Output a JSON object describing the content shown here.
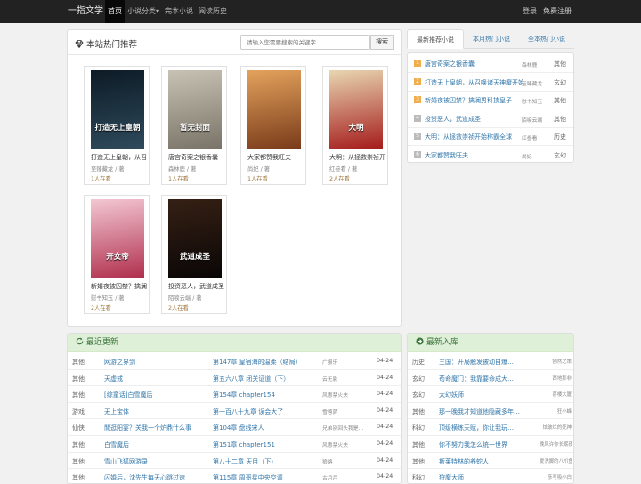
{
  "nav": {
    "brand": "一指文学",
    "links": [
      {
        "label": "首页",
        "active": true
      },
      {
        "label": "小说分类▾",
        "active": false
      },
      {
        "label": "完本小说",
        "active": false
      },
      {
        "label": "阅读历史",
        "active": false
      }
    ],
    "login": "登录",
    "register": "免费注册"
  },
  "hot": {
    "title": "本站热门推荐",
    "search_placeholder": "请输入您需要搜索的关键字",
    "search_button": "搜索",
    "books": [
      {
        "title": "打造无上皇朝，从召唤",
        "author": "至臻藏龙 / 著",
        "reading": "1人在看",
        "cover_colors": [
          "#0d1b26",
          "#2e4a5c"
        ],
        "cover_text": "打造无上皇朝"
      },
      {
        "title": "唐宫奇案之银香囊",
        "author": "森林鹿 / 著",
        "reading": "1人在看",
        "cover_colors": [
          "#c8c2b4",
          "#7a7468"
        ],
        "cover_text": "暂无封面"
      },
      {
        "title": "大家都赞我旺夫",
        "author": "尚妃 / 著",
        "reading": "1人在看",
        "cover_colors": [
          "#e3a25c",
          "#7a3b1a"
        ],
        "cover_text": ""
      },
      {
        "title": "大明：从拯救崇祯开始",
        "author": "红叁看 / 著",
        "reading": "2人在看",
        "cover_colors": [
          "#e8d6b0",
          "#a51c1c"
        ],
        "cover_text": "大明"
      },
      {
        "title": "新婚夜被囚禁？擒澜",
        "author": "慰书知玉 / 著",
        "reading": "2人在看",
        "cover_colors": [
          "#f3c7d3",
          "#b0304e"
        ],
        "cover_text": "开女帝"
      },
      {
        "title": "投资恶人，武道成圣",
        "author": "陌唳云端 / 著",
        "reading": "2人在看",
        "cover_colors": [
          "#352014",
          "#0a0606"
        ],
        "cover_text": "武道成圣"
      }
    ]
  },
  "rank": {
    "tabs": [
      "最新推荐小说",
      "本月热门小说",
      "全本热门小说"
    ],
    "num_colors": [
      "#f0ad4e",
      "#f0ad4e",
      "#f0ad4e",
      "#bbbbbb",
      "#bbbbbb",
      "#bbbbbb"
    ],
    "items": [
      {
        "num": "1",
        "title": "唐宫奇案之银香囊",
        "author": "森林鹿",
        "category": "其他"
      },
      {
        "num": "2",
        "title": "打造无上皇朝，从召唤诸天神魔开始",
        "author": "至臻藏龙",
        "category": "玄幻"
      },
      {
        "num": "3",
        "title": "新婚夜被囚禁？擒澜男科挟皇子",
        "author": "慰书知玉",
        "category": "其他"
      },
      {
        "num": "4",
        "title": "投资恶人，武道成圣",
        "author": "陌唳云端",
        "category": "其他"
      },
      {
        "num": "5",
        "title": "大明：从拯救崇祯开始称霸全球",
        "author": "红叁看",
        "category": "历史"
      },
      {
        "num": "6",
        "title": "大家都赞我旺夫",
        "author": "尚妃",
        "category": "玄幻"
      }
    ]
  },
  "recent": {
    "title": "最近更新",
    "rows": [
      {
        "cat": "其他",
        "title": "网游之界剑",
        "chapter": "第147章 皇宿海的温柔（结局）",
        "author": "广报乐",
        "date": "04-24"
      },
      {
        "cat": "其他",
        "title": "天虚戒",
        "chapter": "第五六八章 闭关证道（下）",
        "author": "云无影",
        "date": "04-24"
      },
      {
        "cat": "其他",
        "title": "[综童话]白雪魔后",
        "chapter": "第154章 chapter154",
        "author": "风惠禁火夫",
        "date": "04-24"
      },
      {
        "cat": "游戏",
        "title": "无上宝体",
        "chapter": "第一百八十九章 误会大了",
        "author": "雪蓉萨",
        "date": "04-24"
      },
      {
        "cat": "仙侠",
        "title": "閒逛阳宴？关我一个炉鼎什么事",
        "author": "兄弟别回头我是…",
        "chapter": "第104章 盘线宋人",
        "date": "04-24"
      },
      {
        "cat": "其他",
        "title": "白雪魔后",
        "chapter": "第151章 chapter151",
        "author": "风惠禁火夫",
        "date": "04-24"
      },
      {
        "cat": "其他",
        "title": "雪山飞狐网游录",
        "chapter": "第八十二章 天目（下）",
        "author": "狼略",
        "date": "04-24"
      },
      {
        "cat": "其他",
        "title": "闪婚后，沈先生每天心跳过速",
        "chapter": "第115章 周哥星中央空调",
        "author": "古月月",
        "date": "04-24"
      }
    ]
  },
  "newin": {
    "title": "最新入库",
    "rows": [
      {
        "cat": "历史",
        "title": "三国：开局触发被动自爆…",
        "author": "刨然之策"
      },
      {
        "cat": "玄幻",
        "title": "苟命魔门：我靠要命成大…",
        "author": "西地那非"
      },
      {
        "cat": "玄幻",
        "title": "太幻妖师",
        "author": "喜楼大厦"
      },
      {
        "cat": "其他",
        "title": "那一晚我才知道他隐藏多年…",
        "author": "狂小蜂"
      },
      {
        "cat": "科幻",
        "title": "顶级横练天赋，你让我玩…",
        "author": "炫破烂的死神"
      },
      {
        "cat": "其他",
        "title": "你不努力我怎么统一世界",
        "author": "晚风许你长眠夜"
      },
      {
        "cat": "其他",
        "title": "斯莱特林的养蛇人",
        "author": "爱洗脚的八爪鱼"
      },
      {
        "cat": "科幻",
        "title": "狩魔大师",
        "author": "彦写吸小白"
      }
    ]
  }
}
